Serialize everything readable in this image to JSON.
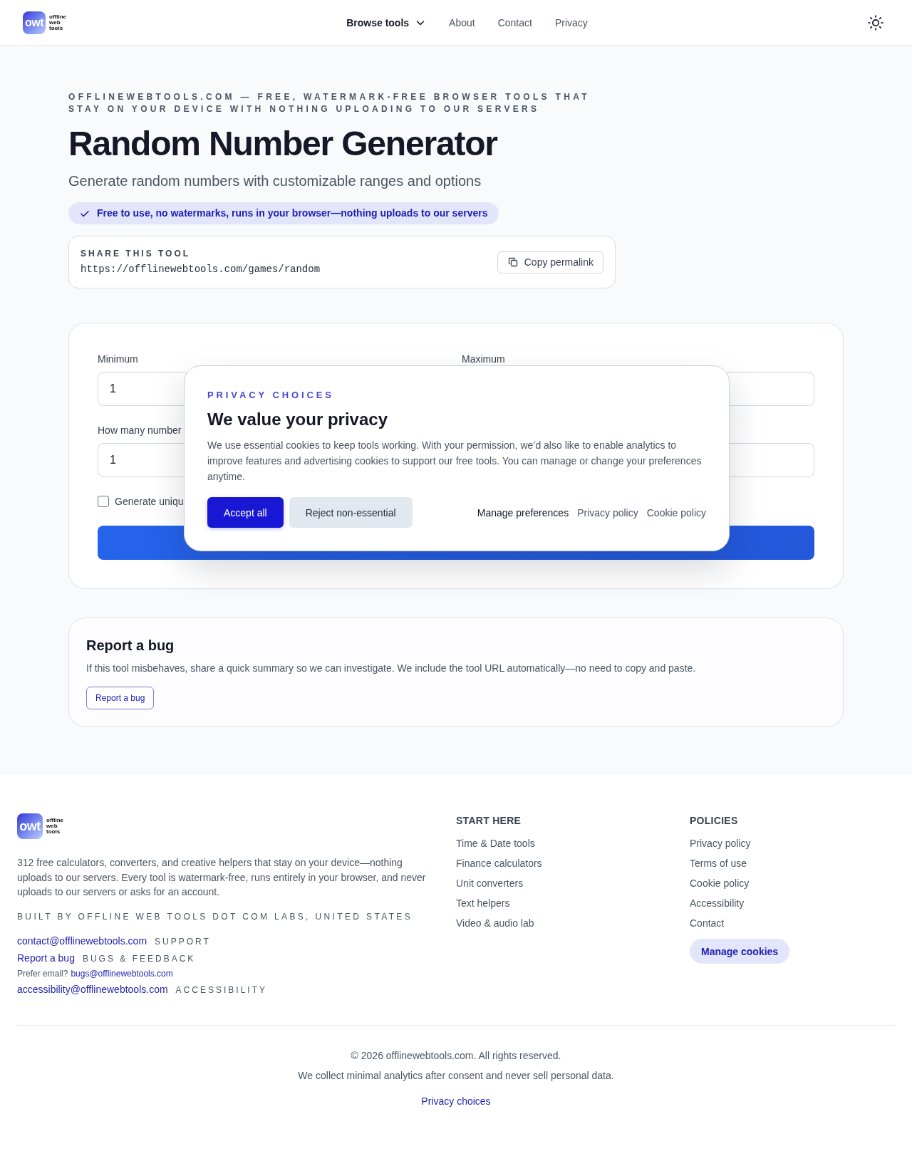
{
  "header": {
    "logo": {
      "mark": "owt",
      "wordmark": "offline web tools"
    },
    "nav": [
      {
        "label": "Browse tools",
        "kind": "menu"
      },
      {
        "label": "About",
        "kind": "link"
      },
      {
        "label": "Contact",
        "kind": "link"
      },
      {
        "label": "Privacy",
        "kind": "link"
      }
    ]
  },
  "hero": {
    "eyebrow": "OFFLINEWEBTOOLS.COM — FREE, WATERMARK-FREE BROWSER TOOLS THAT STAY ON YOUR DEVICE WITH NOTHING UPLOADING TO OUR SERVERS",
    "title": "Random Number Generator",
    "subtitle": "Generate random numbers with customizable ranges and options",
    "badge": "Free to use, no watermarks, runs in your browser—nothing uploads to our servers"
  },
  "share": {
    "label": "SHARE THIS TOOL",
    "url": "https://offlinewebtools.com/games/random",
    "button": "Copy permalink"
  },
  "form": {
    "fields": [
      {
        "label": "Minimum",
        "value": "1"
      },
      {
        "label": "Maximum"
      },
      {
        "label": "How many number",
        "value": "1"
      }
    ],
    "checkbox": {
      "label": "Generate uniqu",
      "checked": false
    }
  },
  "consent_dialog": {
    "eyebrow": "PRIVACY CHOICES",
    "title": "We value your privacy",
    "body": "We use essential cookies to keep tools working. With your permission, we’d also like to enable analytics to improve features and advertising cookies to support our free tools. You can manage or change your preferences anytime.",
    "actions": [
      {
        "label": "Accept all",
        "kind": "primary"
      },
      {
        "label": "Reject non-essential",
        "kind": "secondary"
      }
    ],
    "links": [
      {
        "label": "Manage preferences",
        "kind": "strong"
      },
      {
        "label": "Privacy policy",
        "kind": "plain"
      },
      {
        "label": "Cookie policy",
        "kind": "plain"
      }
    ]
  },
  "report": {
    "title": "Report a bug",
    "text": "If this tool misbehaves, share a quick summary so we can investigate. We include the tool URL automatically—no need to copy and paste.",
    "button": "Report a bug"
  },
  "footer": {
    "logo": {
      "mark": "owt",
      "wordmark": "offline web tools"
    },
    "description": "312 free calculators, converters, and creative helpers that stay on your device—nothing uploads to our servers. Every tool is watermark-free, runs entirely in your browser, and never uploads to our servers or asks for an account.",
    "built_by": "BUILT BY OFFLINE WEB TOOLS DOT COM LABS, UNITED STATES",
    "contacts": [
      {
        "kind": "contact",
        "link": "contact@offlinewebtools.com",
        "tag": "SUPPORT"
      },
      {
        "kind": "contact",
        "link": "Report a bug",
        "tag": "BUGS & FEEDBACK"
      },
      {
        "kind": "note",
        "text": "Prefer email?",
        "link": "bugs@offlinewebtools.com"
      },
      {
        "kind": "contact",
        "link": "accessibility@offlinewebtools.com",
        "tag": "ACCESSIBILITY"
      }
    ],
    "columns": [
      {
        "heading": "START HERE",
        "links": [
          "Time & Date tools",
          "Finance calculators",
          "Unit converters",
          "Text helpers",
          "Video & audio lab"
        ]
      },
      {
        "heading": "POLICIES",
        "links": [
          "Privacy policy",
          "Terms of use",
          "Cookie policy",
          "Accessibility",
          "Contact"
        ],
        "button": "Manage cookies"
      }
    ],
    "copyright": "© 2026 offlinewebtools.com. All rights reserved.",
    "analytics_note": "We collect minimal analytics after consent and never sell personal data.",
    "privacy_link": "Privacy choices"
  }
}
